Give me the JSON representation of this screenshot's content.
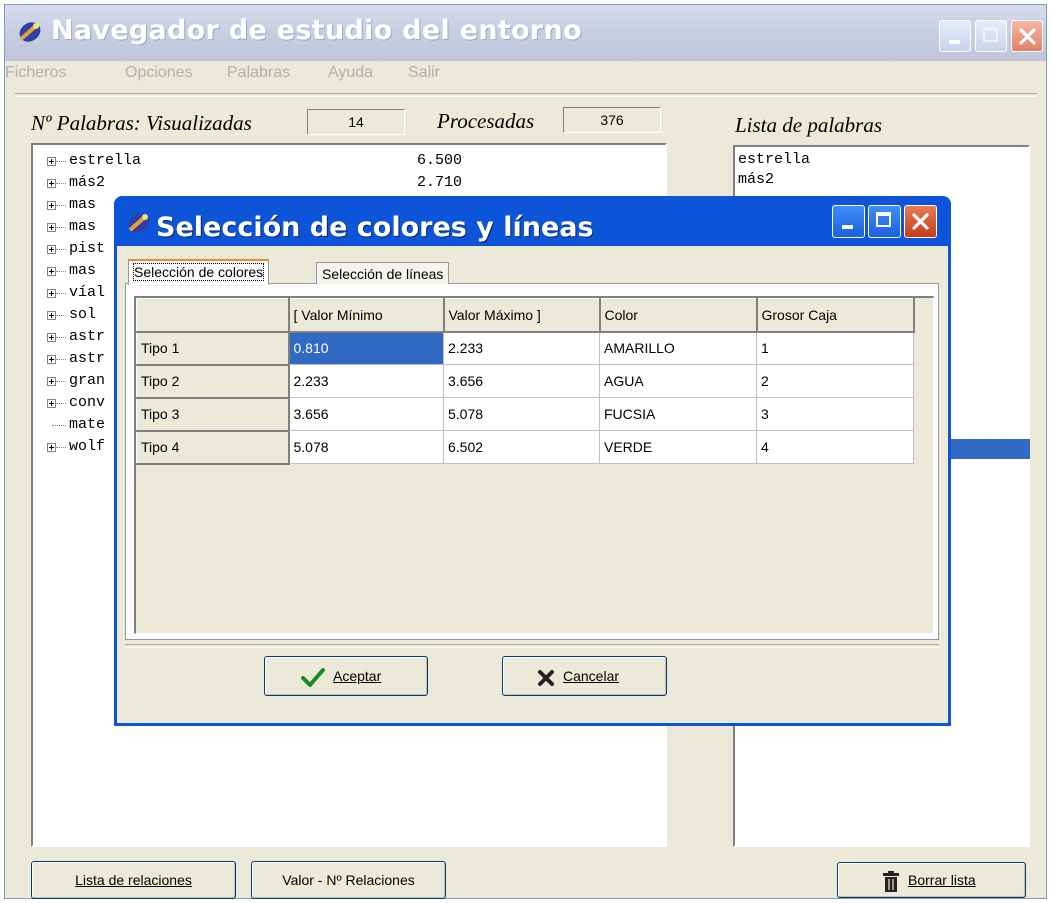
{
  "window": {
    "title": "Navegador de estudio del entorno",
    "menu": [
      "Ficheros",
      "Opciones",
      "Palabras",
      "Ayuda",
      "Salir"
    ]
  },
  "stats": {
    "label_visualizadas": "Nº Palabras: Visualizadas",
    "visualizadas": "14",
    "label_procesadas": "Procesadas",
    "procesadas": "376"
  },
  "tree": {
    "items": [
      {
        "word": "estrella",
        "value": "6.500"
      },
      {
        "word": "más2",
        "value": "2.710"
      },
      {
        "word": "mas",
        "value": ""
      },
      {
        "word": "mas",
        "value": ""
      },
      {
        "word": "pist",
        "value": ""
      },
      {
        "word": "mas",
        "value": ""
      },
      {
        "word": "víal",
        "value": ""
      },
      {
        "word": "sol",
        "value": ""
      },
      {
        "word": "astr",
        "value": ""
      },
      {
        "word": "astr",
        "value": ""
      },
      {
        "word": "gran",
        "value": ""
      },
      {
        "word": "conv",
        "value": ""
      },
      {
        "word": "mate",
        "value": ""
      },
      {
        "word": "wolf",
        "value": ""
      }
    ]
  },
  "word_list": {
    "title": "Lista de palabras",
    "items": [
      "estrella",
      "más2"
    ]
  },
  "bottom_buttons": {
    "relaciones": "Lista de relaciones",
    "valor_relaciones": "Valor - Nº Relaciones",
    "borrar": "Borrar lista"
  },
  "dialog": {
    "title": "Selección de colores y líneas",
    "tabs": [
      "Selección de colores",
      "Selección de líneas"
    ],
    "table": {
      "headers": [
        "",
        "[ Valor Mínimo",
        "Valor Máximo ]",
        "Color",
        "Grosor Caja"
      ],
      "rows": [
        [
          "Tipo 1",
          "0.810",
          "2.233",
          "AMARILLO",
          "1"
        ],
        [
          "Tipo 2",
          "2.233",
          "3.656",
          "AGUA",
          "2"
        ],
        [
          "Tipo 3",
          "3.656",
          "5.078",
          "FUCSIA",
          "3"
        ],
        [
          "Tipo 4",
          "5.078",
          "6.502",
          "VERDE",
          "4"
        ]
      ]
    },
    "accept": "Aceptar",
    "cancel": "Cancelar"
  },
  "colors": {
    "selection": "#316ac5",
    "dialog_titlebar": "#0c54d8",
    "window_face": "#ece9d8"
  }
}
